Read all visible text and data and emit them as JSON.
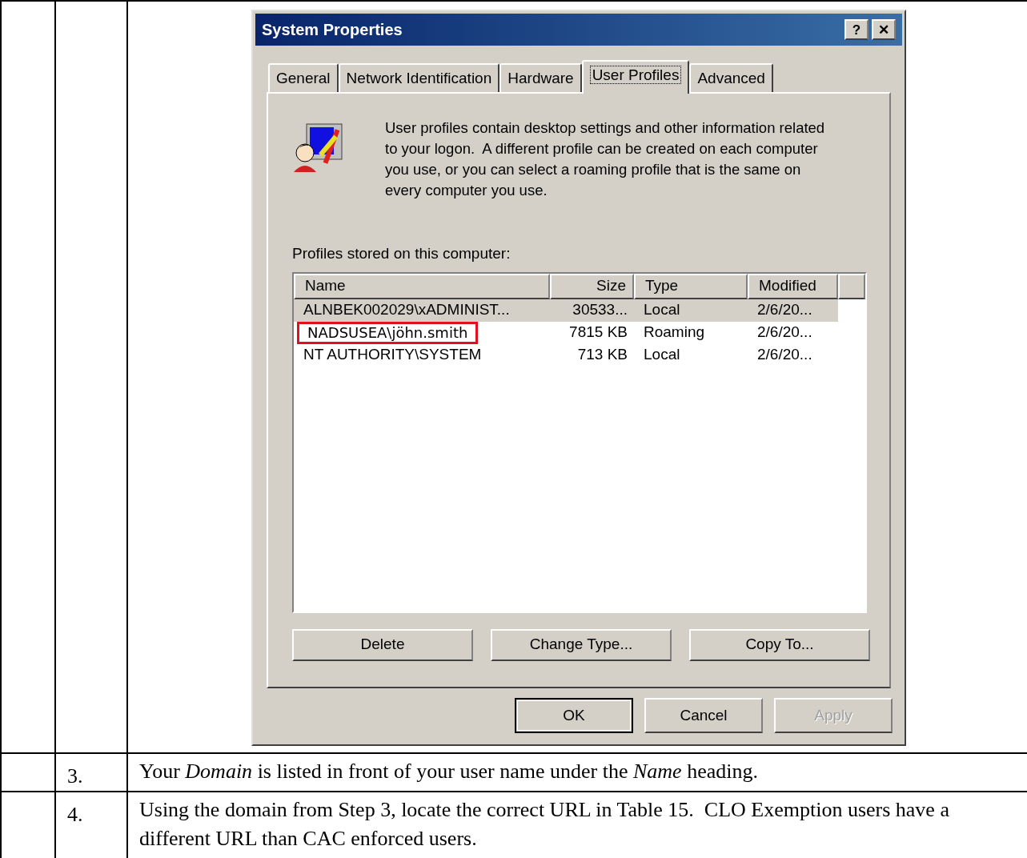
{
  "steps": [
    {
      "kind": "screenshot"
    },
    {
      "number": "3.",
      "kind": "text",
      "text": "Your *Domain* is listed in front of your user name under the *Name* heading."
    },
    {
      "number": "4.",
      "kind": "text",
      "text": "Using the domain from Step 3, locate the correct URL in Table 15.  CLO Exemption users have a different URL than CAC enforced users."
    }
  ],
  "dialog": {
    "title": "System Properties",
    "title_buttons": [
      "?",
      "✕"
    ],
    "tabs": [
      {
        "label": "General",
        "selected": false
      },
      {
        "label": "Network Identification",
        "selected": false
      },
      {
        "label": "Hardware",
        "selected": false
      },
      {
        "label": "User Profiles",
        "selected": true
      },
      {
        "label": "Advanced",
        "selected": false
      }
    ],
    "description": "User profiles contain desktop settings and other information related to your logon.  A different profile can be created on each computer you use, or you can select a roaming profile that is the same on every computer you use.",
    "list_label": "Profiles stored on this computer:",
    "columns": [
      "Name",
      "Size",
      "Type",
      "Modified"
    ],
    "rows": [
      {
        "cells": [
          "ALNBEK002029\\xADMINIST...",
          "30533...",
          "Local",
          "2/6/20..."
        ],
        "selected": true,
        "highlighted": false
      },
      {
        "cells": [
          "NADSUSEA\\jöhn.smith",
          "7815 KB",
          "Roaming",
          "2/6/20..."
        ],
        "selected": false,
        "highlighted": true
      },
      {
        "cells": [
          "NT AUTHORITY\\SYSTEM",
          "713 KB",
          "Local",
          "2/6/20..."
        ],
        "selected": false,
        "highlighted": false
      }
    ],
    "profile_buttons": [
      {
        "label": "Delete",
        "disabled": false
      },
      {
        "label": "Change Type...",
        "disabled": false
      },
      {
        "label": "Copy To...",
        "disabled": false
      }
    ],
    "footer_buttons": [
      {
        "label": "OK",
        "default": true,
        "disabled": false
      },
      {
        "label": "Cancel",
        "default": false,
        "disabled": false
      },
      {
        "label": "Apply",
        "default": false,
        "disabled": true
      }
    ]
  }
}
